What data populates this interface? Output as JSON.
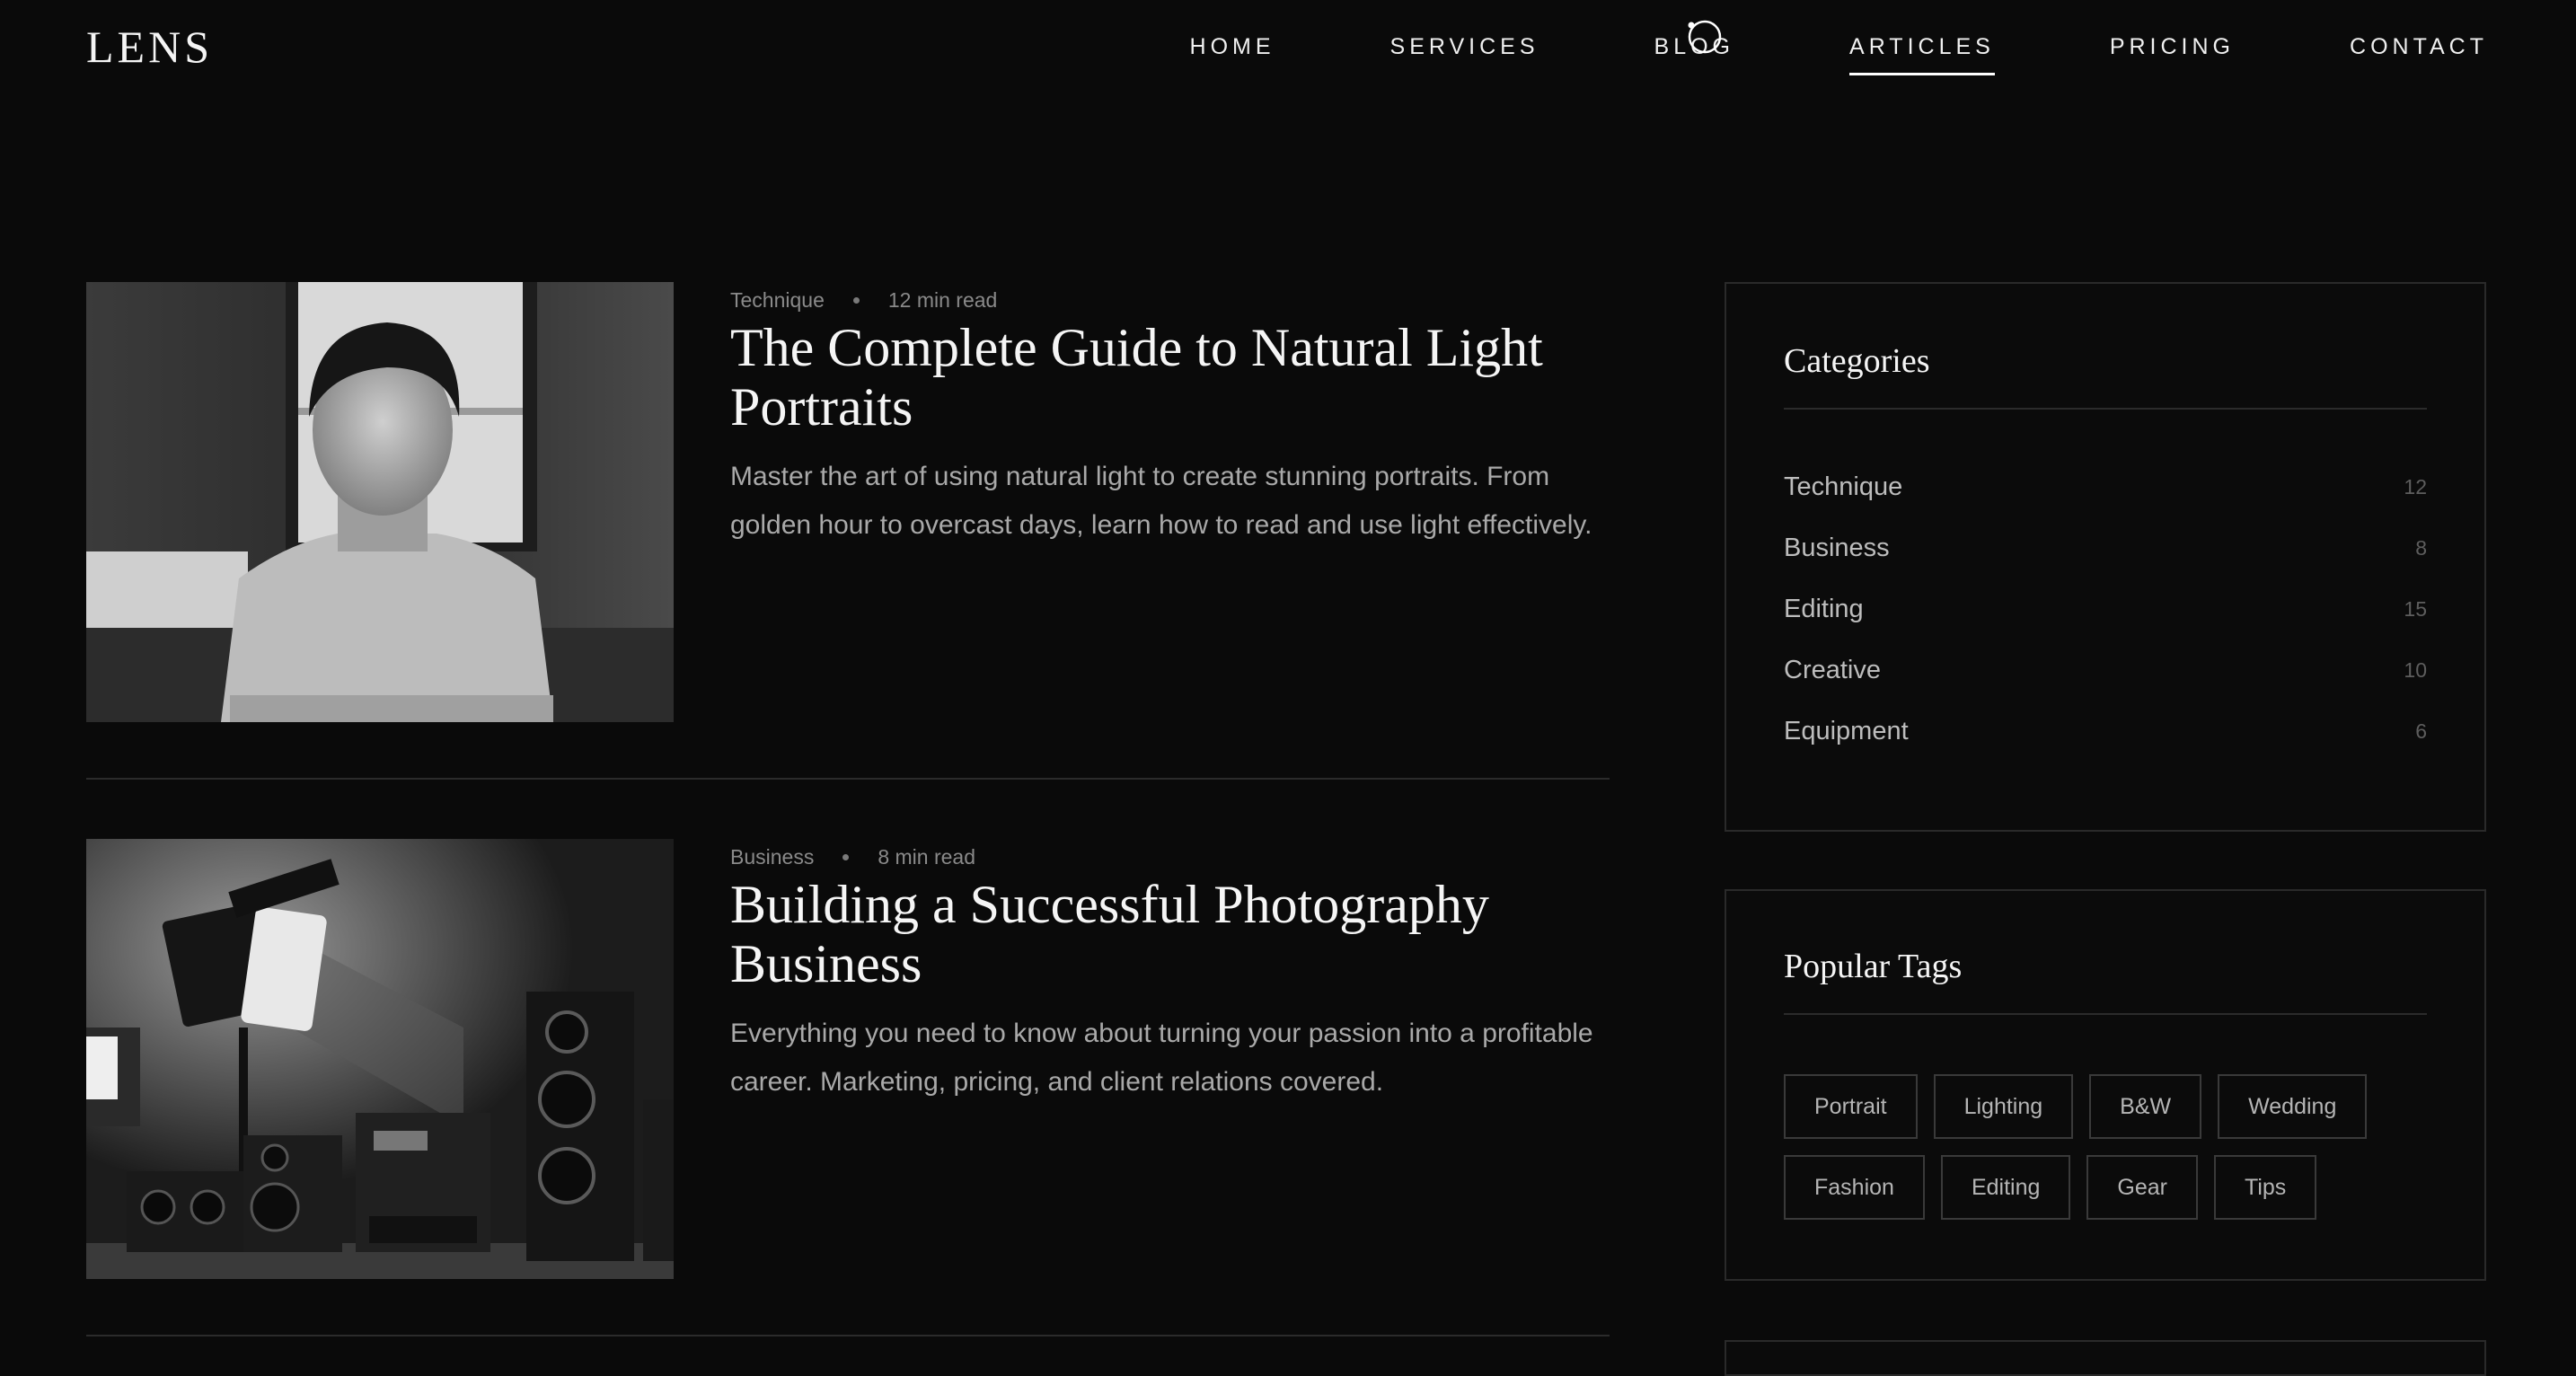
{
  "site": {
    "logo": "LENS"
  },
  "nav": {
    "items": [
      {
        "label": "HOME",
        "active": false
      },
      {
        "label": "SERVICES",
        "active": false
      },
      {
        "label": "BLOG",
        "active": false
      },
      {
        "label": "ARTICLES",
        "active": true
      },
      {
        "label": "PRICING",
        "active": false
      },
      {
        "label": "CONTACT",
        "active": false
      }
    ]
  },
  "articles": [
    {
      "category": "Technique",
      "read_time": "12 min read",
      "title": "The Complete Guide to Natural Light Portraits",
      "excerpt": "Master the art of using natural light to create stunning portraits. From golden hour to overcast days, learn how to read and use light effectively.",
      "image": "portrait-photo"
    },
    {
      "category": "Business",
      "read_time": "8 min read",
      "title": "Building a Successful Photography Business",
      "excerpt": "Everything you need to know about turning your passion into a profitable career. Marketing, pricing, and client relations covered.",
      "image": "studio-equipment-photo"
    }
  ],
  "sidebar": {
    "categories": {
      "title": "Categories",
      "items": [
        {
          "name": "Technique",
          "count": "12"
        },
        {
          "name": "Business",
          "count": "8"
        },
        {
          "name": "Editing",
          "count": "15"
        },
        {
          "name": "Creative",
          "count": "10"
        },
        {
          "name": "Equipment",
          "count": "6"
        }
      ]
    },
    "tags": {
      "title": "Popular Tags",
      "items": [
        "Portrait",
        "Lighting",
        "B&W",
        "Wedding",
        "Fashion",
        "Editing",
        "Gear",
        "Tips"
      ]
    }
  },
  "colors": {
    "background": "#0a0a0a",
    "text": "#f5f5f5",
    "muted": "#a9a9a9",
    "border": "#2a2a2a"
  }
}
